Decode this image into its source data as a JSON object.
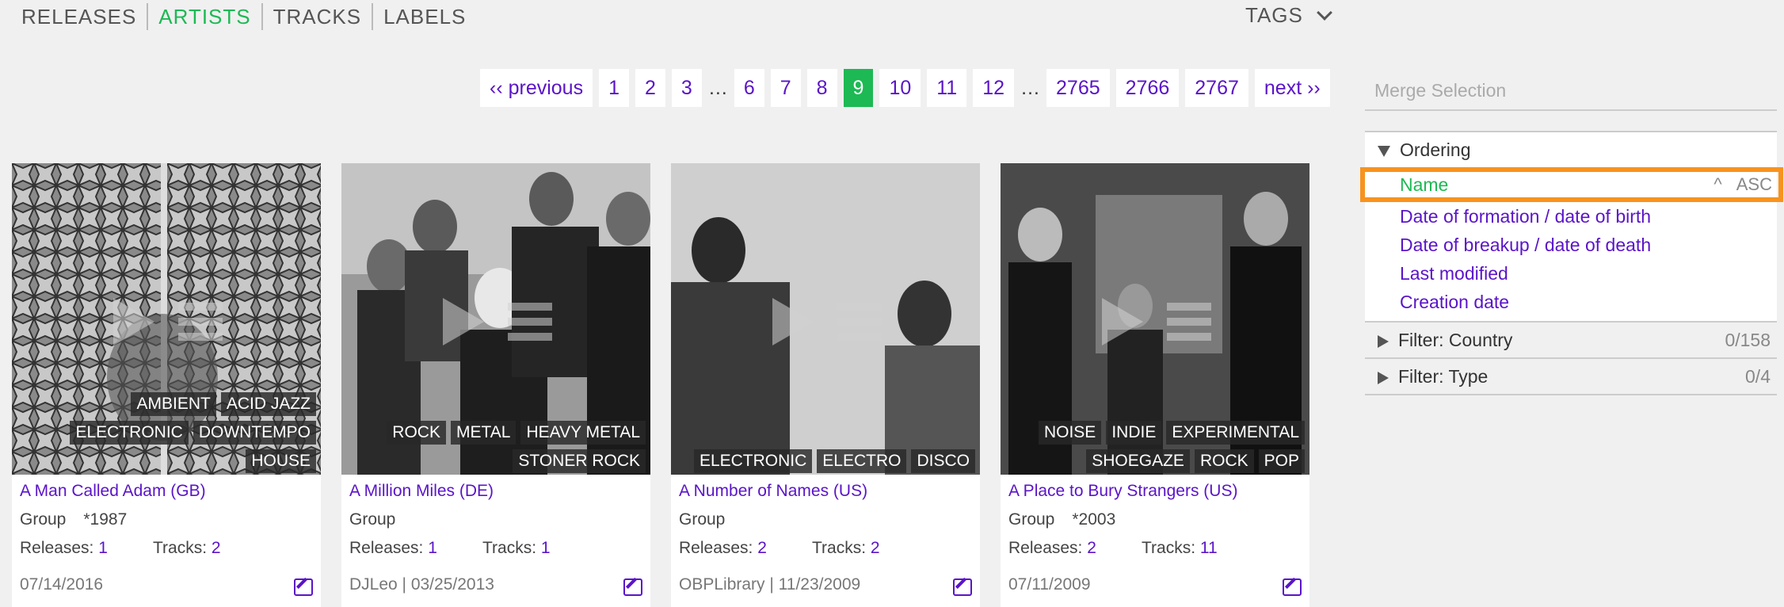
{
  "nav": {
    "items": [
      "RELEASES",
      "ARTISTS",
      "TRACKS",
      "LABELS"
    ],
    "active": "ARTISTS",
    "tags_label": "TAGS"
  },
  "pagination": {
    "previous": "‹‹ previous",
    "next": "next ››",
    "pages": [
      "1",
      "2",
      "3",
      "…",
      "6",
      "7",
      "8",
      "9",
      "10",
      "11",
      "12",
      "…",
      "2765",
      "2766",
      "2767"
    ],
    "current": "9"
  },
  "cards": [
    {
      "name": "A Man Called Adam (GB)",
      "type": "Group",
      "year": "*1987",
      "releases_label": "Releases:",
      "releases": "1",
      "tracks_label": "Tracks:",
      "tracks": "2",
      "footer": "07/14/2016",
      "tag_rows": [
        [
          "AMBIENT",
          "ACID JAZZ"
        ],
        [
          "ELECTRONIC",
          "DOWNTEMPO"
        ],
        [
          "HOUSE"
        ]
      ]
    },
    {
      "name": "A Million Miles (DE)",
      "type": "Group",
      "year": "",
      "releases_label": "Releases:",
      "releases": "1",
      "tracks_label": "Tracks:",
      "tracks": "1",
      "footer": "DJLeo | 03/25/2013",
      "tag_rows": [
        [
          "ROCK",
          "METAL",
          "HEAVY METAL"
        ],
        [
          "STONER ROCK"
        ]
      ]
    },
    {
      "name": "A Number of Names (US)",
      "type": "Group",
      "year": "",
      "releases_label": "Releases:",
      "releases": "2",
      "tracks_label": "Tracks:",
      "tracks": "2",
      "footer": "OBPLibrary | 11/23/2009",
      "tag_rows": [
        [
          "ELECTRONIC",
          "ELECTRO",
          "DISCO"
        ]
      ]
    },
    {
      "name": "A Place to Bury Strangers (US)",
      "type": "Group",
      "year": "*2003",
      "releases_label": "Releases:",
      "releases": "2",
      "tracks_label": "Tracks:",
      "tracks": "11",
      "footer": "07/11/2009",
      "tag_rows": [
        [
          "NOISE",
          "INDIE",
          "EXPERIMENTAL"
        ],
        [
          "SHOEGAZE",
          "ROCK",
          "POP"
        ]
      ]
    }
  ],
  "sidebar": {
    "merge_placeholder": "Merge Selection",
    "ordering_title": "Ordering",
    "ordering_options": [
      {
        "label": "Name",
        "selected": true,
        "caret": "^",
        "direction": "ASC"
      },
      {
        "label": "Date of formation / date of birth"
      },
      {
        "label": "Date of breakup / date of death"
      },
      {
        "label": "Last modified"
      },
      {
        "label": "Creation date"
      }
    ],
    "filters": [
      {
        "label": "Filter: Country",
        "count": "0/158"
      },
      {
        "label": "Filter: Type",
        "count": "0/4"
      }
    ]
  },
  "colors": {
    "accent_green": "#1db954",
    "link_purple": "#5a14c8",
    "highlight_orange": "#f7931e"
  }
}
